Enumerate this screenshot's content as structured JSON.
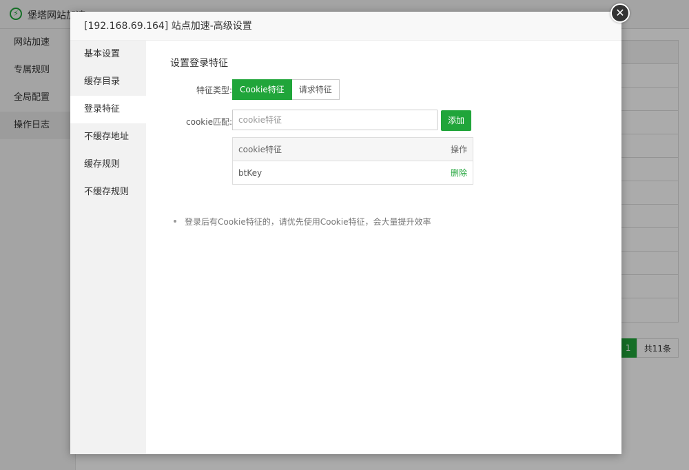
{
  "background": {
    "app_title": "堡塔网站加速",
    "sidebar_items": [
      "网站加速",
      "专属规则",
      "全局配置",
      "操作日志"
    ],
    "pager": {
      "current": "1",
      "total": "共11条"
    }
  },
  "modal": {
    "title": "[192.168.69.164] 站点加速-高级设置",
    "close_glyph": "✕",
    "tabs": [
      "基本设置",
      "缓存目录",
      "登录特征",
      "不缓存地址",
      "缓存规则",
      "不缓存规则"
    ],
    "active_tab": "登录特征",
    "section_title": "设置登录特征",
    "type_label": "特征类型:",
    "type_options": [
      "Cookie特征",
      "请求特征"
    ],
    "cookie_label": "cookie匹配:",
    "cookie_placeholder": "cookie特征",
    "add_button": "添加",
    "table": {
      "headers": [
        "cookie特征",
        "操作"
      ],
      "rows": [
        {
          "name": "btKey",
          "action": "删除"
        }
      ]
    },
    "tips": [
      "登录后有Cookie特征的，请优先使用Cookie特征，会大量提升效率"
    ]
  },
  "colors": {
    "accent": "#20a53a"
  }
}
